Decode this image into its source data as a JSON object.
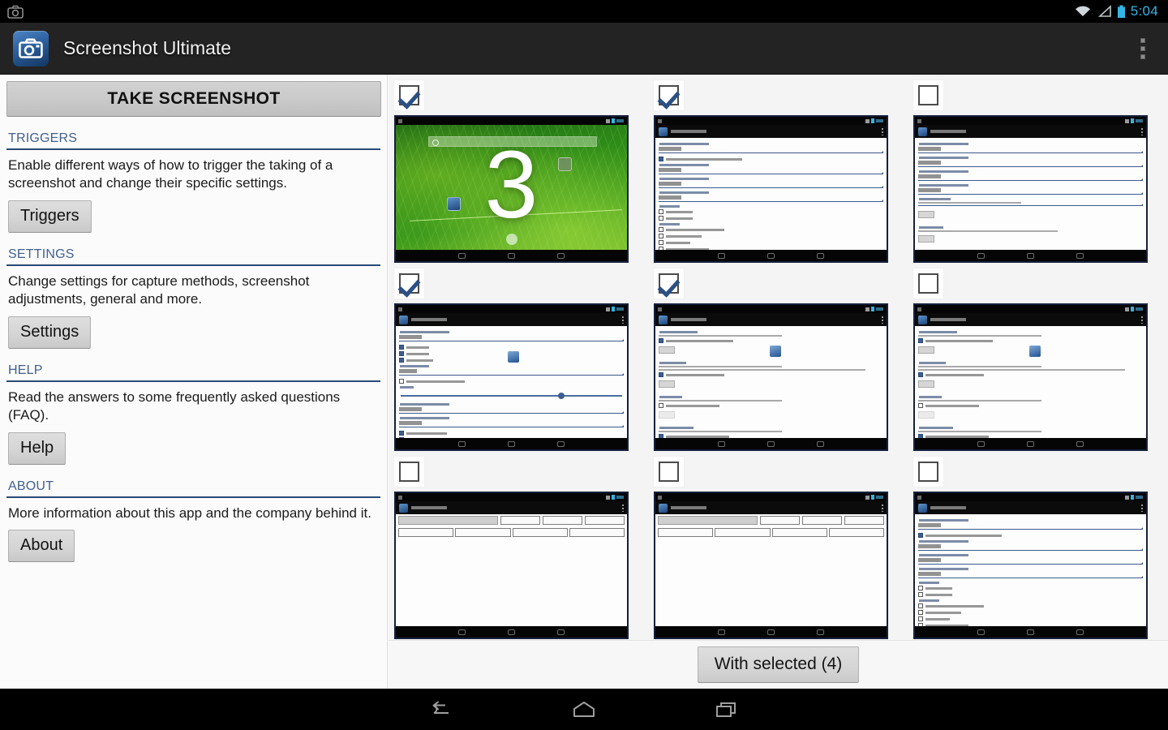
{
  "status_bar": {
    "clock": "5:04",
    "icons": [
      "screenshot-notification-icon",
      "wifi-icon",
      "signal-icon",
      "battery-icon"
    ],
    "accent_color": "#33b5e5"
  },
  "app_bar": {
    "title": "Screenshot Ultimate",
    "icon": "camera-app-icon",
    "overflow": "overflow-menu-icon"
  },
  "sidebar": {
    "take_screenshot_label": "TAKE SCREENSHOT",
    "sections": [
      {
        "heading": "TRIGGERS",
        "description": "Enable different ways of how to trigger the taking of a screenshot and change their specific settings.",
        "button": "Triggers"
      },
      {
        "heading": "SETTINGS",
        "description": "Change settings for capture methods, screenshot adjustments, general and more.",
        "button": "Settings"
      },
      {
        "heading": "HELP",
        "description": "Read the answers to some frequently asked questions (FAQ).",
        "button": "Help"
      },
      {
        "heading": "ABOUT",
        "description": "More information about this app and the company behind it.",
        "button": "About"
      }
    ],
    "heading_color": "#41608f",
    "rule_color": "#2b4a77"
  },
  "gallery": {
    "items": [
      {
        "index": 1,
        "checked": true,
        "kind": "countdown",
        "countdown": "3"
      },
      {
        "index": 2,
        "checked": true,
        "kind": "settings-form"
      },
      {
        "index": 3,
        "checked": false,
        "kind": "settings-paths"
      },
      {
        "index": 4,
        "checked": true,
        "kind": "settings-slider"
      },
      {
        "index": 5,
        "checked": true,
        "kind": "settings-text"
      },
      {
        "index": 6,
        "checked": false,
        "kind": "settings-text"
      },
      {
        "index": 7,
        "checked": false,
        "kind": "app-recursive"
      },
      {
        "index": 8,
        "checked": false,
        "kind": "app-recursive"
      },
      {
        "index": 9,
        "checked": false,
        "kind": "settings-form"
      }
    ],
    "checkbox_check_color": "#2b4f86"
  },
  "bottom_bar": {
    "with_selected_label": "With selected (4)",
    "selected_count": 4
  },
  "nav_bar": {
    "buttons": [
      "back-icon",
      "home-icon",
      "recents-icon"
    ]
  }
}
